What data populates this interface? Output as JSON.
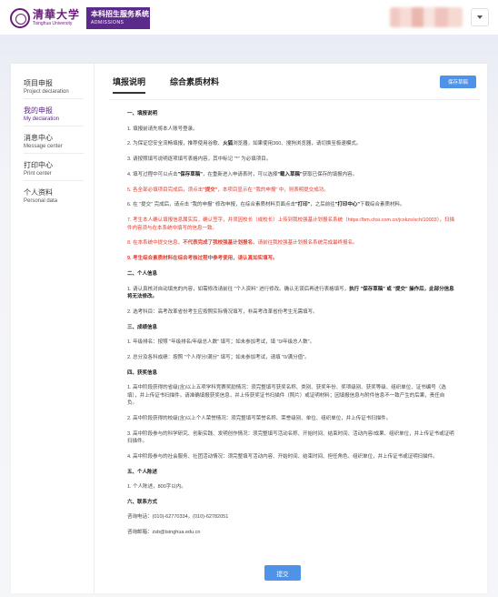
{
  "header": {
    "logo_cn": "清華大学",
    "logo_en": "Tsinghua University",
    "system_title": "本科招生服务系统",
    "system_subtitle": "ADMISSIONS"
  },
  "sidebar": {
    "items": [
      {
        "cn": "项目申报",
        "en": "Project declaration",
        "active": false
      },
      {
        "cn": "我的申报",
        "en": "My declaration",
        "active": true
      },
      {
        "cn": "消息中心",
        "en": "Message center",
        "active": false
      },
      {
        "cn": "打印中心",
        "en": "Print center",
        "active": false
      },
      {
        "cn": "个人资料",
        "en": "Personal data",
        "active": false
      }
    ]
  },
  "tabs": [
    {
      "label": "填报说明",
      "active": true
    },
    {
      "label": "综合素质材料",
      "active": false
    }
  ],
  "toolbar": {
    "save_label": "保存草稿"
  },
  "content": {
    "s1": "一、填报说明",
    "p1": "1. 填报前请先将本人账号登录。",
    "p2a": "2. 为保证您安全流畅填报，推荐使用谷歌、",
    "p2b": "火狐",
    "p2c": "浏览器，如果使用360、搜狗浏览器，请切换至极速模式。",
    "p3": "3. 请按照填写说明逐项填写表格内容，其中标记 \"*\" 为必填项目。",
    "p4a": "4. 填写过程中可以点击",
    "p4b": "\"保存草稿\"",
    "p4c": "，在重新进入申请表时，可以选择",
    "p4d": "\"载入草稿\"",
    "p4e": "获取已保存的填报内容。",
    "p5a": "5. 各全部必填项目完成后，须点击",
    "p5b": "\"提交\"",
    "p5c": "，本项目显示在 \"我的申报\" 中，则表明提交成功。",
    "p6a": "6. 在 \"提交\" 完成后，请点击 \"我的申报\" 修改申报，在综合素质材料页面点击",
    "p6b": "\"打印\"",
    "p6c": "，之后前往",
    "p6d": "\"打印中心\"",
    "p6e": "下载综合素质材料。",
    "p7": "7. 考生本人确认填报信息属实后，确认签字，并须因校长（或校长）上传到我校强基计划报名系统（https://bm.chsi.com.cn/jcxkzs/sch/10003），扫描件内容须与在本系统中填写的信息一致。",
    "p8a": "8. 在本系统中提交信息，",
    "p8b": "不代表完成了我校强基计划报名",
    "p8c": "，请前往我校强基计划报名系统完成最终报名。",
    "p9": "9. 考生综合素质材料在综合考核过程中参考使用，请认真如实填写。",
    "s2": "二、个人信息",
    "p10a": "1. 请认真核对自动填充的内容，如需修改请前往 \"个人资料\" 进行修改。确认无误后再进行表格填写，",
    "p10b": "执行 \"保存草稿\" 或 \"提交\" 操作后，此部分信息将无法修改。",
    "p11": "2. 选考科目：高考改革省份考生应按照实际情况填写，非高考改革省份考生无需填写。",
    "s3": "三、成绩信息",
    "p12": "1. 年级排名：按照 \"年级排名/年级总人数\" 填写；如未参加考试，填 \"0/年级总人数\"。",
    "p13": "2. 总分及各科成绩：按照 \"个人得分/满分\" 填写；如未参加考试，请填 \"0/满分值\"。",
    "s4": "四、获奖信息",
    "p14": "1. 高中阶段获得的省级(含)以上五项学科竞赛奖励情况：须完整填写获奖名称、类别、获奖年份、奖项级别、获奖等级、组织单位、证书编号（选填），并上传证书扫描件。请准确填报获奖信息，并上传获奖证书扫描件（照片）或证明材料；因填报信息与附件信息不一致产生的后果，责任自负。",
    "p15": "2. 高中阶段获得的校级(含)以上个人荣誉情况：须完整填写荣誉名称、荣誉级别、单位、组织单位，并上传证书扫描件。",
    "p16": "3. 高中阶段参与的科学研究、创新实践、发明创作情况：须完整填写活动名称、开始时间、结束时间、活动内容/成果、组织单位，并上传证书或证明扫描件。",
    "p17": "4. 高中阶段参与的社会服务、社团活动情况：须完整填写活动内容、开始时间、结束时间、担任角色、组织单位，并上传证书或证明扫描件。",
    "s5": "五、个人陈述",
    "p18": "1. 个人陈述，800字以内。",
    "s6": "六、联系方式",
    "phone": "咨询电话：(010)-62770334，(010)-62782051",
    "email": "咨询邮箱：zsb@tsinghua.edu.cn"
  },
  "footer": {
    "submit_label": "提交"
  },
  "colors": {
    "accent_purple": "#5c2a8a",
    "button_blue": "#4e93e8",
    "alert_red": "#e03b2d"
  }
}
